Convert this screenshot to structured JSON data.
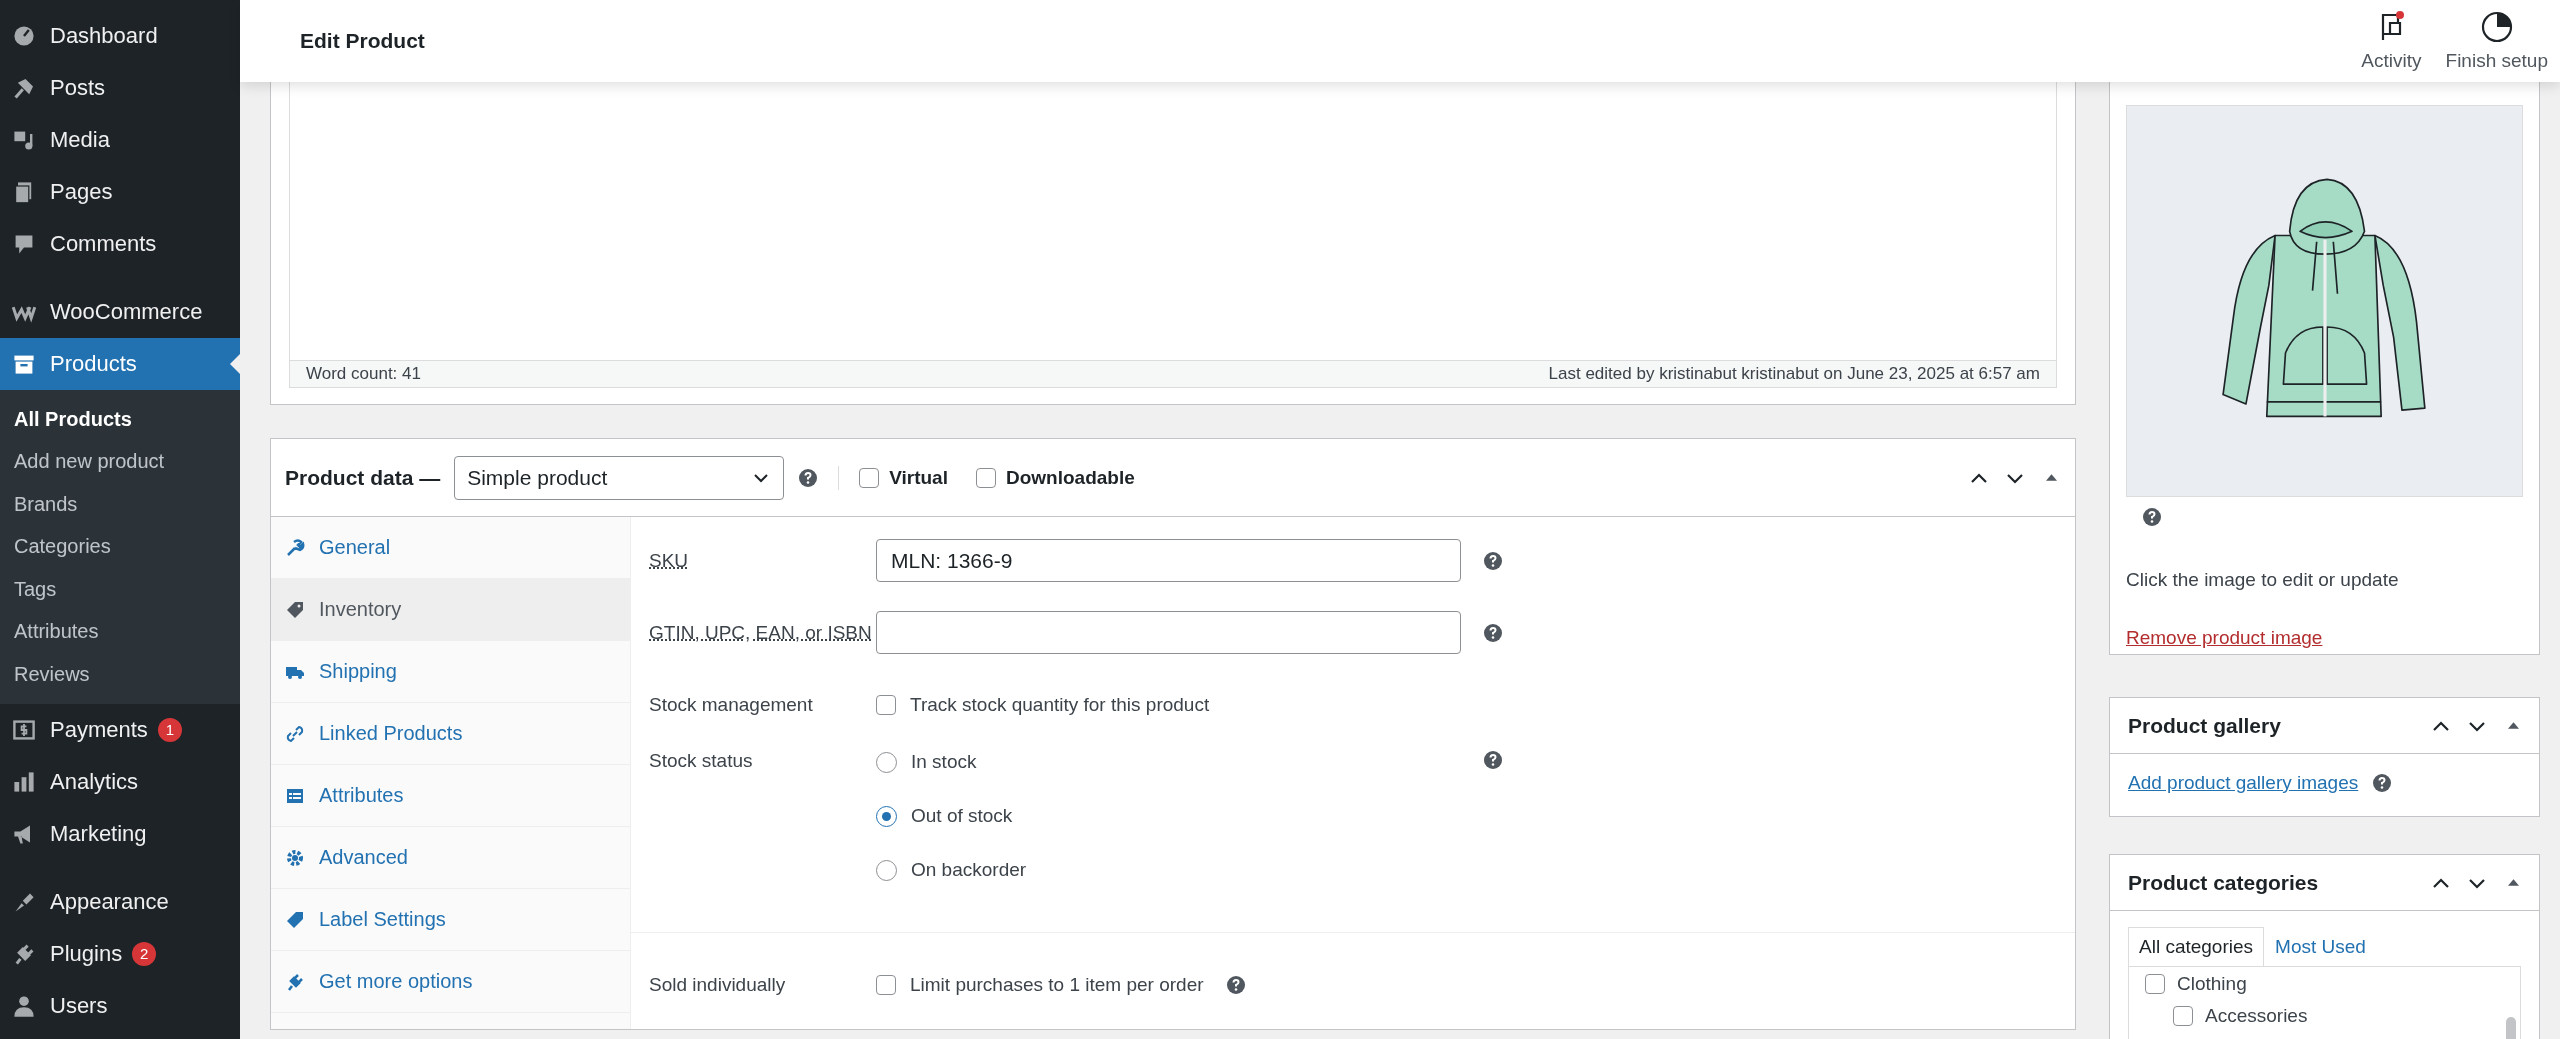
{
  "sidebar": {
    "items": [
      {
        "label": "Dashboard",
        "selected": false
      },
      {
        "label": "Posts",
        "selected": false
      },
      {
        "label": "Media",
        "selected": false
      },
      {
        "label": "Pages",
        "selected": false
      },
      {
        "label": "Comments",
        "selected": false
      },
      {
        "label": "WooCommerce",
        "selected": false
      },
      {
        "label": "Products",
        "selected": true,
        "children": [
          {
            "label": "All Products",
            "selected": true
          },
          {
            "label": "Add new product",
            "selected": false
          },
          {
            "label": "Brands",
            "selected": false
          },
          {
            "label": "Categories",
            "selected": false
          },
          {
            "label": "Tags",
            "selected": false
          },
          {
            "label": "Attributes",
            "selected": false
          },
          {
            "label": "Reviews",
            "selected": false
          }
        ]
      },
      {
        "label": "Payments",
        "selected": false,
        "badge": "1"
      },
      {
        "label": "Analytics",
        "selected": false
      },
      {
        "label": "Marketing",
        "selected": false
      },
      {
        "label": "Appearance",
        "selected": false
      },
      {
        "label": "Plugins",
        "selected": false,
        "badge": "2"
      },
      {
        "label": "Users",
        "selected": false
      }
    ]
  },
  "header": {
    "title": "Edit Product",
    "actions": [
      {
        "label": "Activity",
        "notification": true
      },
      {
        "label": "Finish setup",
        "notification": false
      }
    ]
  },
  "editor": {
    "word_count": "Word count: 41",
    "last_edited": "Last edited by kristinabut kristinabut on June 23, 2025 at 6:57 am"
  },
  "product_data": {
    "title": "Product data —",
    "product_type": "Simple product",
    "options": [
      {
        "label": "Virtual",
        "checked": false
      },
      {
        "label": "Downloadable",
        "checked": false
      }
    ],
    "tabs": [
      {
        "label": "General",
        "selected": false
      },
      {
        "label": "Inventory",
        "selected": true
      },
      {
        "label": "Shipping",
        "selected": false
      },
      {
        "label": "Linked Products",
        "selected": false
      },
      {
        "label": "Attributes",
        "selected": false
      },
      {
        "label": "Advanced",
        "selected": false
      },
      {
        "label": "Label Settings",
        "selected": false
      },
      {
        "label": "Get more options",
        "selected": false
      }
    ],
    "fields": [
      {
        "kind": "text",
        "label": "SKU",
        "value": "MLN: 1366-9",
        "help": true
      },
      {
        "kind": "text",
        "label": "GTIN, UPC, EAN, or ISBN",
        "help": true
      },
      {
        "kind": "checkbox",
        "label": "Stock management",
        "text": "Track stock quantity for this product",
        "checked": false
      },
      {
        "kind": "radio",
        "label": "Stock status",
        "help": true,
        "options": [
          {
            "label": "In stock",
            "selected": false
          },
          {
            "label": "Out of stock",
            "selected": true
          },
          {
            "label": "On backorder",
            "selected": false
          }
        ]
      }
    ],
    "sold_individually": {
      "label": "Sold individually",
      "text": "Limit purchases to 1 item per order",
      "checked": false,
      "help": true
    }
  },
  "product_image": {
    "hint": "Click the image to edit or update",
    "remove_link": "Remove product image"
  },
  "product_gallery": {
    "title": "Product gallery",
    "link": "Add product gallery images"
  },
  "product_categories": {
    "title": "Product categories",
    "tabs": [
      {
        "label": "All categories",
        "selected": true
      },
      {
        "label": "Most Used",
        "selected": false
      }
    ],
    "items": [
      {
        "label": "Clothing",
        "checked": false,
        "children": [
          {
            "label": "Accessories",
            "checked": false
          }
        ]
      }
    ]
  }
}
